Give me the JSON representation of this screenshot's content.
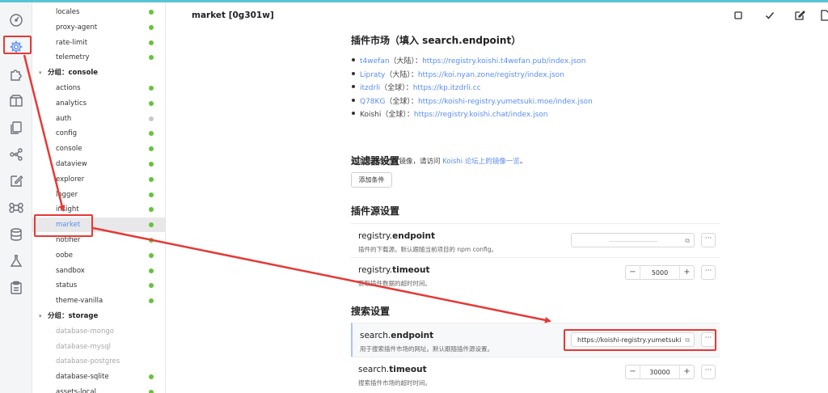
{
  "header": {
    "title": "market [0g301w]"
  },
  "tree": {
    "items": [
      {
        "label": "locales",
        "status": "green"
      },
      {
        "label": "proxy-agent",
        "status": "green"
      },
      {
        "label": "rate-limit",
        "status": "green"
      },
      {
        "label": "telemetry",
        "status": "green"
      },
      {
        "label": "分组：console",
        "group": true
      },
      {
        "label": "actions",
        "status": "green"
      },
      {
        "label": "analytics",
        "status": "green"
      },
      {
        "label": "auth",
        "status": "grey"
      },
      {
        "label": "config",
        "status": "green"
      },
      {
        "label": "console",
        "status": "green"
      },
      {
        "label": "dataview",
        "status": "green"
      },
      {
        "label": "explorer",
        "status": "green"
      },
      {
        "label": "logger",
        "status": "green"
      },
      {
        "label": "insight",
        "status": "green"
      },
      {
        "label": "market",
        "status": "green",
        "selected": true
      },
      {
        "label": "notifier",
        "status": "green"
      },
      {
        "label": "oobe",
        "status": "green"
      },
      {
        "label": "sandbox",
        "status": "green"
      },
      {
        "label": "status",
        "status": "green"
      },
      {
        "label": "theme-vanilla",
        "status": "green"
      },
      {
        "label": "分组：storage",
        "group": true
      },
      {
        "label": "database-mongo",
        "disabled": true
      },
      {
        "label": "database-mysql",
        "disabled": true
      },
      {
        "label": "database-postgres",
        "disabled": true
      },
      {
        "label": "database-sqlite",
        "status": "green"
      },
      {
        "label": "assets-local",
        "status": "green"
      }
    ]
  },
  "market": {
    "heading": "插件市场（填入 search.endpoint）",
    "mirrors": [
      {
        "name": "t4wefan",
        "region": "（大陆）：",
        "url": "https://registry.koishi.t4wefan.pub/index.json",
        "name_link": true
      },
      {
        "name": "Lipraty",
        "region": "（大陆）：",
        "url": "https://koi.nyan.zone/registry/index.json",
        "name_link": true
      },
      {
        "name": "itzdrli",
        "region": "（全球）：",
        "url": "https://kp.itzdrli.cc",
        "name_link": true
      },
      {
        "name": "Q78KG",
        "region": "（全球）：",
        "url": "https://koishi-registry.yumetsuki.moe/index.json",
        "name_link": true
      },
      {
        "name": "Koishi",
        "region": "（全球）：",
        "url": "https://registry.koishi.chat/index.json",
        "name_link": false
      }
    ],
    "note_prefix": "要浏览更多社区镜像，请访问 ",
    "note_link": "Koishi 论坛上的镜像一览",
    "note_suffix": "。"
  },
  "filter": {
    "heading": "过滤器设置",
    "add_label": "添加条件"
  },
  "source": {
    "heading": "插件源设置",
    "endpoint": {
      "prefix": "registry.",
      "key": "endpoint",
      "desc": "插件的下载源。默认跟随当前项目的 npm config。",
      "value": ""
    },
    "timeout": {
      "prefix": "registry.",
      "key": "timeout",
      "desc": "获取插件数据的超时时间。",
      "value": "5000"
    }
  },
  "search": {
    "heading": "搜索设置",
    "endpoint": {
      "prefix": "search.",
      "key": "endpoint",
      "desc": "用于搜索插件市场的网址。默认跟随插件源设置。",
      "value": "https://koishi-registry.yumetsuki.moe"
    },
    "timeout": {
      "prefix": "search.",
      "key": "timeout",
      "desc": "搜索插件市场的超时时间。",
      "value": "30000"
    }
  },
  "glyphs": {
    "minus": "−",
    "plus": "+",
    "more": "···",
    "external": "⧉"
  },
  "colors": {
    "accent": "#5b8def",
    "status_green": "#67c23a",
    "annotation_red": "#e53935"
  },
  "icons": {
    "activity_bar": [
      "dashboard-icon",
      "settings-gear-icon",
      "puzzle-icon",
      "box-icon",
      "files-icon",
      "network-icon",
      "edit-icon",
      "command-icon",
      "database-icon",
      "flask-icon",
      "clipboard-icon"
    ],
    "header": [
      "stop-square-icon",
      "check-icon",
      "edit-icon"
    ]
  }
}
